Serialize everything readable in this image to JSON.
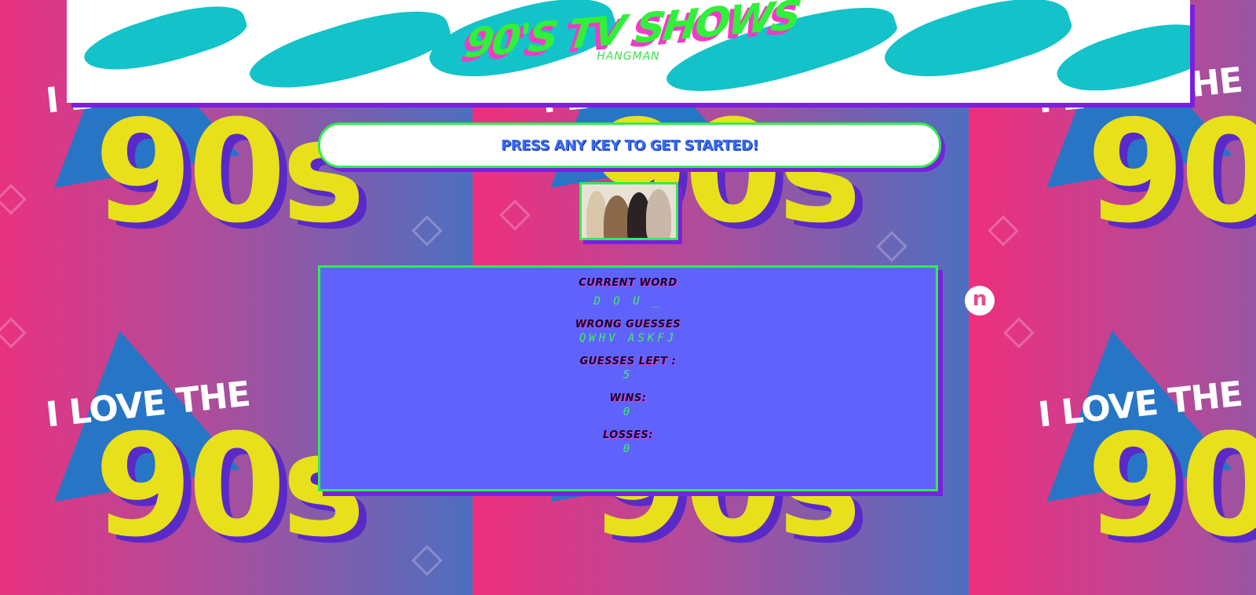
{
  "header": {
    "title": "90'S TV SHOWS",
    "subtitle": "HANGMAN"
  },
  "banner": {
    "text": "PRESS ANY KEY TO GET STARTED!"
  },
  "show_image": {
    "icon": "cast-photo"
  },
  "game": {
    "current_word_label": "CURRENT WORD",
    "current_word_value": "D O U _",
    "wrong_guesses_label": "WRONG GUESSES",
    "wrong_guesses_value": "QWHV ASKFJ",
    "guesses_left_label": "GUESSES LEFT :",
    "guesses_left_value": "5",
    "wins_label": "WINS:",
    "wins_value": "0",
    "losses_label": "LOSSES:",
    "losses_value": "0"
  },
  "background": {
    "tile_line1": "I LOVE THE",
    "tile_line2": "90s"
  },
  "extension_icon": {
    "glyph": "n",
    "icon": "extension-icon"
  },
  "colors": {
    "accent_green": "#2cf04a",
    "shadow_purple": "#7b1fe0",
    "panel_blue": "#6063fb",
    "title_pink": "#f13bc8",
    "yellow": "#e8e01b"
  }
}
